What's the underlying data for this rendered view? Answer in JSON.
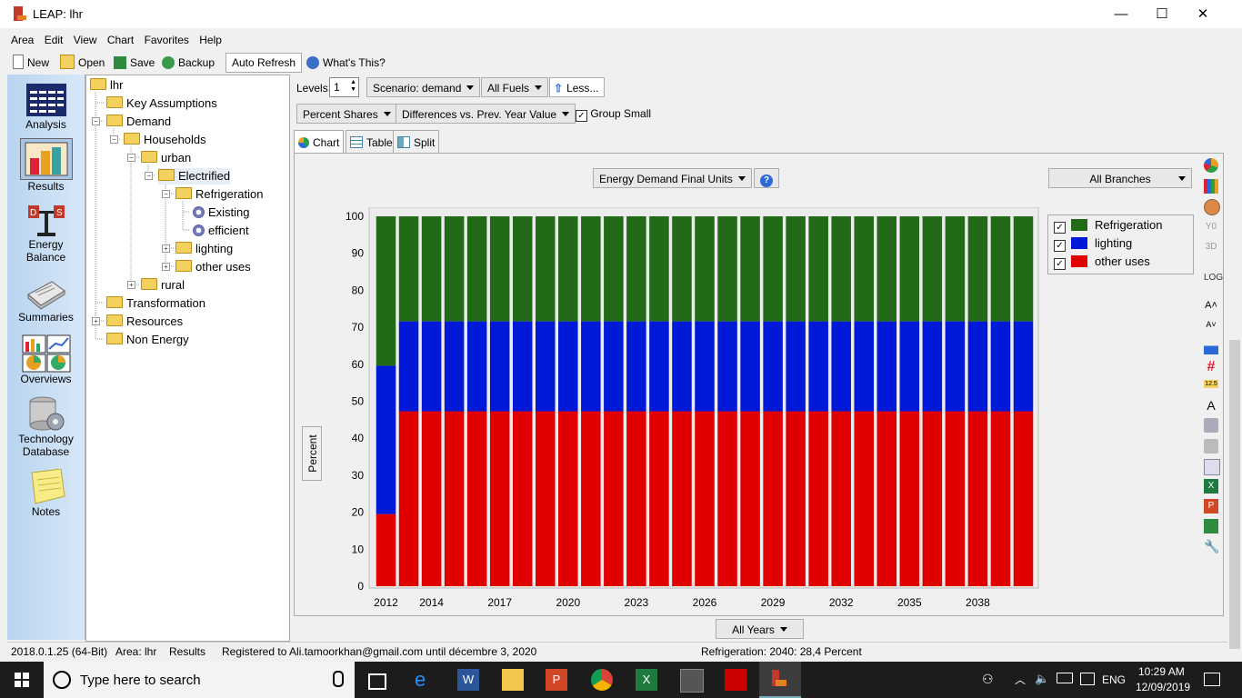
{
  "window": {
    "title": "LEAP: lhr",
    "min": "—",
    "max": "☐",
    "close": "✕"
  },
  "menu": [
    "Area",
    "Edit",
    "View",
    "Chart",
    "Favorites",
    "Help"
  ],
  "toolbar": {
    "new": "New",
    "open": "Open",
    "save": "Save",
    "backup": "Backup",
    "auto_refresh": "Auto Refresh",
    "whats_this": "What's This?"
  },
  "nav": [
    {
      "label1": "Analysis",
      "label2": ""
    },
    {
      "label1": "Results",
      "label2": ""
    },
    {
      "label1": "Energy",
      "label2": "Balance"
    },
    {
      "label1": "Summaries",
      "label2": ""
    },
    {
      "label1": "Overviews",
      "label2": ""
    },
    {
      "label1": "Technology",
      "label2": "Database"
    },
    {
      "label1": "Notes",
      "label2": ""
    }
  ],
  "tree": [
    "lhr",
    "Key Assumptions",
    "Demand",
    "Households",
    "urban",
    "Electrified",
    "Refrigeration",
    "Existing",
    "efficient",
    "lighting",
    "other uses",
    "rural",
    "Transformation",
    "Resources",
    "Non Energy"
  ],
  "controls": {
    "levels_label": "Levels:",
    "levels_value": "1",
    "scenario": "Scenario: demand",
    "fuels": "All Fuels",
    "less": "Less...",
    "percent": "Percent Shares",
    "diff": "Differences vs. Prev. Year Value",
    "group_small": "Group Small"
  },
  "tabs": [
    "Chart",
    "Table",
    "Split"
  ],
  "chart_panel": {
    "units": "Energy Demand Final Units",
    "help": "?",
    "branches": "All Branches",
    "years": "All Years"
  },
  "chart_data": {
    "type": "bar",
    "stacked": true,
    "ylabel": "Percent",
    "ylim": [
      0,
      100
    ],
    "yticks": [
      0,
      10,
      20,
      30,
      40,
      50,
      60,
      70,
      80,
      90,
      100
    ],
    "xticks": [
      "2012",
      "2014",
      "2017",
      "2020",
      "2023",
      "2026",
      "2029",
      "2032",
      "2035",
      "2038"
    ],
    "categories": [
      "2012",
      "2013",
      "2014",
      "2015",
      "2016",
      "2017",
      "2018",
      "2019",
      "2020",
      "2021",
      "2022",
      "2023",
      "2024",
      "2025",
      "2026",
      "2027",
      "2028",
      "2029",
      "2030",
      "2031",
      "2032",
      "2033",
      "2034",
      "2035",
      "2036",
      "2037",
      "2038",
      "2039",
      "2040"
    ],
    "series": [
      {
        "name": "other uses",
        "color": "#e00000",
        "values": [
          19.5,
          47.3,
          47.3,
          47.3,
          47.3,
          47.3,
          47.3,
          47.3,
          47.3,
          47.3,
          47.3,
          47.3,
          47.3,
          47.3,
          47.3,
          47.3,
          47.3,
          47.3,
          47.3,
          47.3,
          47.3,
          47.3,
          47.3,
          47.3,
          47.3,
          47.3,
          47.3,
          47.3,
          47.3
        ]
      },
      {
        "name": "lighting",
        "color": "#0018d8",
        "values": [
          40.1,
          24.3,
          24.3,
          24.3,
          24.3,
          24.3,
          24.3,
          24.3,
          24.3,
          24.3,
          24.3,
          24.3,
          24.3,
          24.3,
          24.3,
          24.3,
          24.3,
          24.3,
          24.3,
          24.3,
          24.3,
          24.3,
          24.3,
          24.3,
          24.3,
          24.3,
          24.3,
          24.3,
          24.3
        ]
      },
      {
        "name": "Refrigeration",
        "color": "#226a18",
        "values": [
          40.4,
          28.4,
          28.4,
          28.4,
          28.4,
          28.4,
          28.4,
          28.4,
          28.4,
          28.4,
          28.4,
          28.4,
          28.4,
          28.4,
          28.4,
          28.4,
          28.4,
          28.4,
          28.4,
          28.4,
          28.4,
          28.4,
          28.4,
          28.4,
          28.4,
          28.4,
          28.4,
          28.4,
          28.4
        ]
      }
    ],
    "legend": "top-right",
    "grid": false
  },
  "legend": [
    {
      "name": "Refrigeration",
      "color": "#226a18"
    },
    {
      "name": "lighting",
      "color": "#0018d8"
    },
    {
      "name": "other uses",
      "color": "#e00000"
    }
  ],
  "status": {
    "version": "2018.0.1.25 (64-Bit)",
    "area": "Area: lhr",
    "view": "Results",
    "registered": "Registered to Ali.tamoorkhan@gmail.com until décembre 3, 2020",
    "hover": "Refrigeration: 2040: 28,4 Percent"
  },
  "taskbar": {
    "search": "Type here to search",
    "lang": "ENG",
    "time": "10:29 AM",
    "date": "12/09/2019"
  }
}
